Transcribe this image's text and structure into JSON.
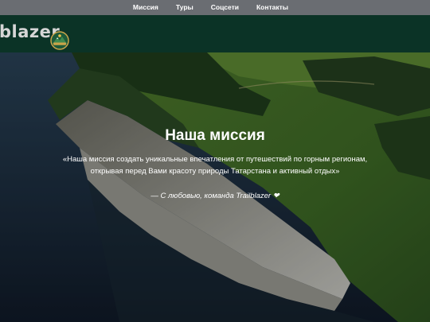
{
  "nav": {
    "items": [
      {
        "label": "Миссия"
      },
      {
        "label": "Туры"
      },
      {
        "label": "Соцсети"
      },
      {
        "label": "Контакты"
      }
    ]
  },
  "brand": {
    "logo_text": "blazer",
    "badge_icon": "trailblazer-badge-icon"
  },
  "hero": {
    "title": "Наша миссия",
    "text_line1": "«Наша миссия создать уникальные впечатления от путешествий по горным регионам,",
    "text_line2": "открывая перед Вами красоту природы Татарстана и активный отдых»",
    "signature": "— С любовью, команда Trailblazer ❤"
  },
  "colors": {
    "nav_bg": "#6a6d72",
    "brand_bg": "#0b3326",
    "text": "#ffffff"
  }
}
